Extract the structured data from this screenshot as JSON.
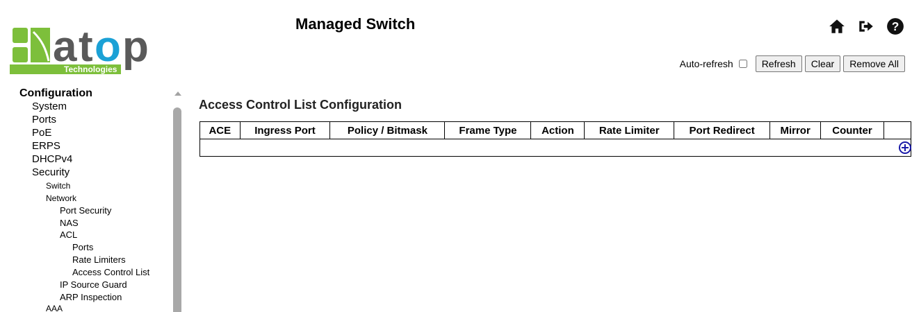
{
  "brand": {
    "logo_word": "atop",
    "logo_sub": "Technologies",
    "colors": {
      "green": "#7dbf3b",
      "blue": "#1ba1d6",
      "gray": "#5a5a5a"
    }
  },
  "header": {
    "title": "Managed Switch",
    "icons": [
      "home-icon",
      "logout-icon",
      "help-icon"
    ]
  },
  "toolbar": {
    "auto_refresh_label": "Auto-refresh",
    "auto_refresh_checked": false,
    "refresh_label": "Refresh",
    "clear_label": "Clear",
    "remove_all_label": "Remove All"
  },
  "sidebar": {
    "items": [
      {
        "label": "Configuration",
        "level": 0
      },
      {
        "label": "System",
        "level": 1
      },
      {
        "label": "Ports",
        "level": 1
      },
      {
        "label": "PoE",
        "level": 1
      },
      {
        "label": "ERPS",
        "level": 1
      },
      {
        "label": "DHCPv4",
        "level": 1
      },
      {
        "label": "Security",
        "level": 1
      },
      {
        "label": "Switch",
        "level": 2
      },
      {
        "label": "Network",
        "level": 2
      },
      {
        "label": "Port Security",
        "level": 3
      },
      {
        "label": "NAS",
        "level": 3
      },
      {
        "label": "ACL",
        "level": 3
      },
      {
        "label": "Ports",
        "level": 4
      },
      {
        "label": "Rate Limiters",
        "level": 4
      },
      {
        "label": "Access Control List",
        "level": 4
      },
      {
        "label": "IP Source Guard",
        "level": 3
      },
      {
        "label": "ARP Inspection",
        "level": 3
      },
      {
        "label": "AAA",
        "level": 2
      }
    ]
  },
  "main": {
    "page_title": "Access Control List Configuration",
    "table": {
      "columns": [
        "ACE",
        "Ingress Port",
        "Policy / Bitmask",
        "Frame Type",
        "Action",
        "Rate Limiter",
        "Port Redirect",
        "Mirror",
        "Counter",
        ""
      ],
      "rows": []
    },
    "add_icon": "plus-circle-icon",
    "accent_color": "#1a1aa8"
  }
}
